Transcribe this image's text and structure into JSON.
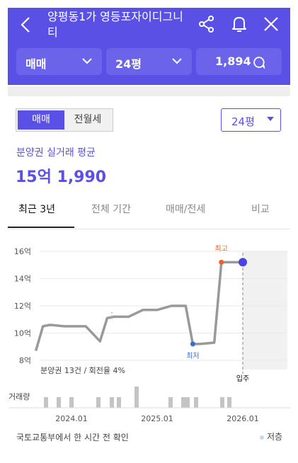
{
  "header": {
    "title": "양평동1가 영등포자이디그니티",
    "filters": {
      "trade": "매매",
      "size": "24평",
      "comments": "1,894"
    }
  },
  "segment": {
    "active": "매매",
    "inactive": "전월세"
  },
  "size_dropdown": "24평",
  "summary": {
    "label": "분양권 실거래 평균",
    "value": "15억 1,990"
  },
  "tabs": [
    "최근 3년",
    "전체 기간",
    "매매/전세",
    "비교"
  ],
  "chart_labels": {
    "volume_label": "거래량",
    "note": "분양권 13건 / 회전율 4%",
    "low": "최저",
    "high": "최고",
    "movein": "입주"
  },
  "chart_data": {
    "type": "line",
    "y_ticks": [
      "16억",
      "14억",
      "12억",
      "10억",
      "8억"
    ],
    "ylim": [
      8,
      16
    ],
    "x_ticks": [
      "2024.01",
      "2025.01",
      "2026.01"
    ],
    "x": [
      "2023.08",
      "2023.09",
      "2023.10",
      "2023.12",
      "2024.03",
      "2024.05",
      "2024.06",
      "2024.07",
      "2024.09",
      "2024.11",
      "2025.01",
      "2025.03",
      "2025.05",
      "2025.06",
      "2025.07",
      "2025.09",
      "2025.10",
      "2025.11",
      "2025.12",
      "2026.01"
    ],
    "series": [
      {
        "values": [
          8.7,
          10.5,
          10.6,
          10.5,
          10.5,
          9.4,
          11.1,
          11.2,
          11.2,
          11.7,
          11.7,
          12.0,
          12.0,
          9.2,
          9.2,
          9.3,
          15.2,
          15.2,
          15.2,
          15.2
        ]
      }
    ],
    "volume_bars": [
      1,
      1,
      1,
      1,
      1,
      1,
      2,
      1,
      1,
      1,
      1,
      1,
      1,
      1,
      1,
      1,
      1
    ],
    "lowest": 9.2,
    "highest": 15.2
  },
  "footer": {
    "source": "국토교통부에서 한 시간 전 확인",
    "legend": "저층"
  }
}
